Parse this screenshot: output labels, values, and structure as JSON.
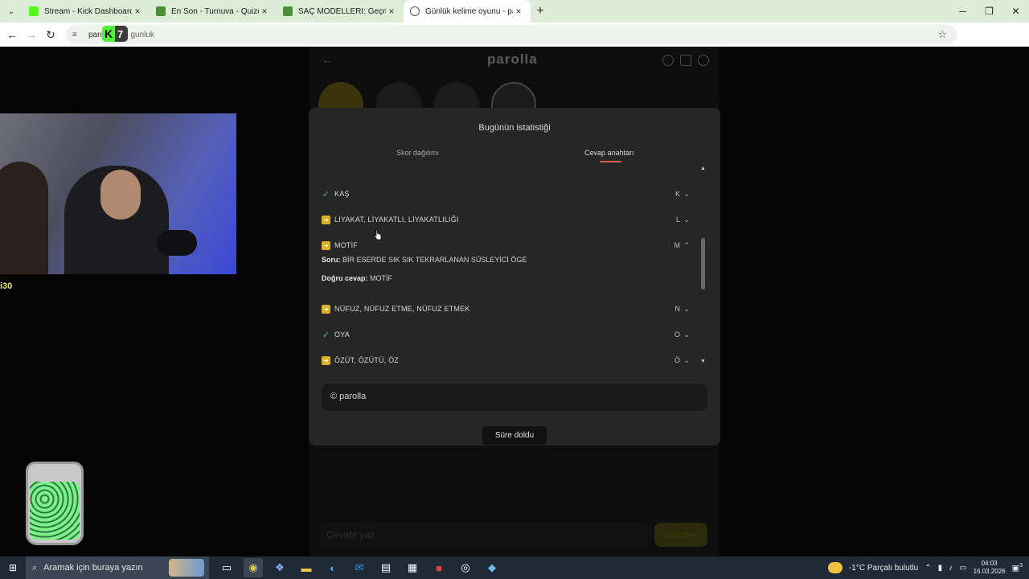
{
  "browser": {
    "tabs": [
      {
        "label": "Stream - Kick Dashboard",
        "favicon_color": "#53fc18"
      },
      {
        "label": "En Son - Turnuva - Quizei",
        "favicon_color": "#4c8f3a"
      },
      {
        "label": "SAÇ MODELLERİ: Geçmişten Gü",
        "favicon_color": "#4c8f3a"
      },
      {
        "label": "Günlük kelime oyunu - parolla",
        "favicon_color": "#ffffff"
      }
    ],
    "url": "parolla.app/gunluk",
    "url_visible": "paroll",
    "url_suffix": "gunluk",
    "overlay_badge": {
      "letter": "K",
      "number": "7"
    }
  },
  "page": {
    "logo": "parolla",
    "modal": {
      "title": "Bugünün istatistiği",
      "tabs": [
        "Skor dağılımı",
        "Cevap anahtarı"
      ],
      "active_tab": "Cevap anahtarı",
      "rows": [
        {
          "status": "correct",
          "word": "KAŞ",
          "letter": "K",
          "expanded": false
        },
        {
          "status": "passed",
          "word": "LİYAKAT, LİYAKATLI, LİYAKATLILIĞI",
          "letter": "L",
          "expanded": false
        },
        {
          "status": "passed",
          "word": "MOTİF",
          "letter": "M",
          "expanded": true
        },
        {
          "status": "passed",
          "word": "NÜFUZ, NÜFUZ ETME, NÜFUZ ETMEK",
          "letter": "N",
          "expanded": false
        },
        {
          "status": "correct",
          "word": "OYA",
          "letter": "O",
          "expanded": false
        },
        {
          "status": "passed",
          "word": "ÖZÜT, ÖZÜTÜ, ÖZ",
          "letter": "Ö",
          "expanded": false
        }
      ],
      "detail": {
        "question_label": "Soru:",
        "question": "BİR ESERDE SIK SIK TEKRARLANAN SÜSLEYİCİ ÖGE",
        "answer_label": "Doğru cevap:",
        "answer": "MOTİF"
      },
      "footer": "© parolla",
      "time_button": "Süre doldu"
    },
    "bottom_input_placeholder": "Cevabı yaz",
    "bottom_button": "Gönder"
  },
  "stream_overlay": {
    "text": "i30"
  },
  "taskbar": {
    "search_placeholder": "Aramak için buraya yazın",
    "weather": "-1°C  Parçalı bulutlu",
    "time": "04:03",
    "date": "16.03.2026",
    "notification_count": "3"
  }
}
